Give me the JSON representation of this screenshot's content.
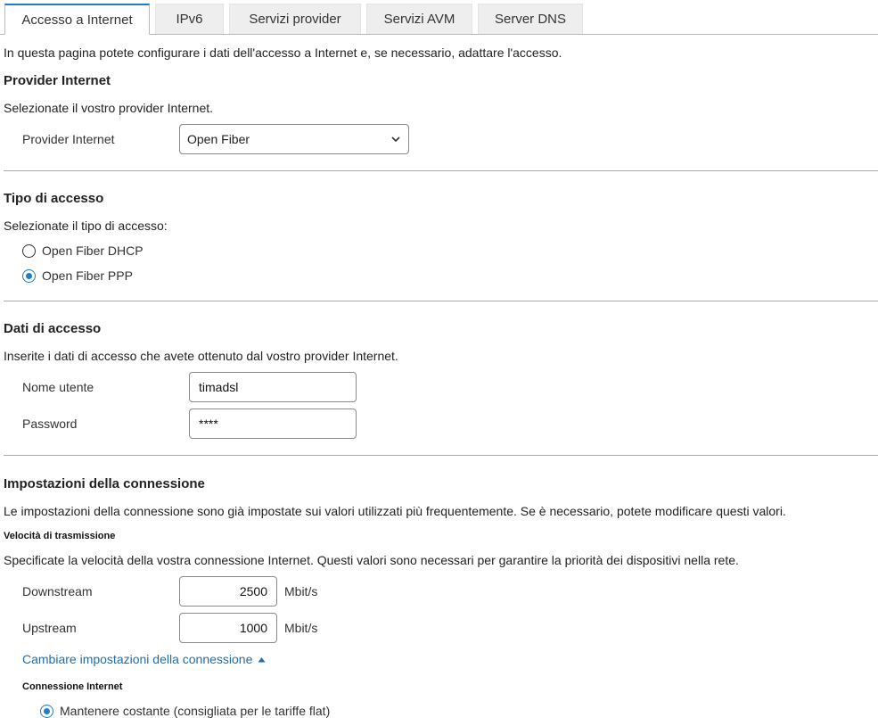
{
  "tabs": [
    {
      "label": "Accesso a Internet",
      "active": true
    },
    {
      "label": "IPv6"
    },
    {
      "label": "Servizi provider"
    },
    {
      "label": "Servizi AVM"
    },
    {
      "label": "Server DNS"
    }
  ],
  "intro": "In questa pagina potete configurare i dati dell'accesso a Internet e, se necessario, adattare l'accesso.",
  "provider": {
    "heading": "Provider Internet",
    "description": "Selezionate il vostro provider Internet.",
    "label": "Provider Internet",
    "selected": "Open Fiber"
  },
  "access_type": {
    "heading": "Tipo di accesso",
    "description": "Selezionate il tipo di accesso:",
    "options": [
      {
        "label": "Open Fiber DHCP",
        "checked": false
      },
      {
        "label": "Open Fiber PPP",
        "checked": true
      }
    ]
  },
  "credentials": {
    "heading": "Dati di accesso",
    "description": "Inserite i dati di accesso che avete ottenuto dal vostro provider Internet.",
    "username_label": "Nome utente",
    "username_value": "timadsl",
    "password_label": "Password",
    "password_value": "****"
  },
  "connection": {
    "heading": "Impostazioni della connessione",
    "description": "Le impostazioni della connessione sono già impostate sui valori utilizzati più frequentemente. Se è necessario, potete modificare questi valori.",
    "speed_heading": "Velocità di trasmissione",
    "speed_description": "Specificate la velocità della vostra connessione Internet. Questi valori sono necessari per garantire la priorità dei dispositivi nella rete.",
    "downstream_label": "Downstream",
    "downstream_value": "2500",
    "upstream_label": "Upstream",
    "upstream_value": "1000",
    "unit": "Mbit/s",
    "change_link": "Cambiare impostazioni della connessione",
    "internet_connection_heading": "Connessione Internet",
    "keep_option": "Mantenere costante (consigliata per le tariffe flat)"
  },
  "colors": {
    "accent": "#1f7fc2",
    "link": "#1f6ea8"
  }
}
